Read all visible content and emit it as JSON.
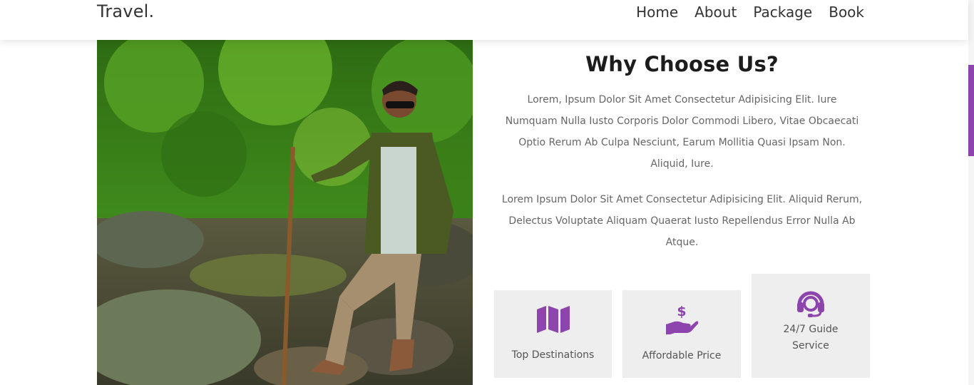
{
  "header": {
    "logo": "Travel.",
    "nav": [
      "Home",
      "About",
      "Package",
      "Book"
    ]
  },
  "about": {
    "title": "Why Choose Us?",
    "paragraphs": [
      "Lorem, Ipsum Dolor Sit Amet Consectetur Adipisicing Elit. Iure Numquam Nulla Iusto Corporis Dolor Commodi Libero, Vitae Obcaecati Optio Rerum Ab Culpa Nesciunt, Earum Mollitia Quasi Ipsam Non. Aliquid, Iure.",
      "Lorem Ipsum Dolor Sit Amet Consectetur Adipisicing Elit. Aliquid Rerum, Delectus Voluptate Aliquam Quaerat Iusto Repellendus Error Nulla Ab Atque."
    ],
    "features": [
      {
        "label": "Top Destinations",
        "icon": "map-icon"
      },
      {
        "label": "Affordable Price",
        "icon": "hand-dollar-icon"
      },
      {
        "label": "24/7 Guide Service",
        "icon": "headset-icon"
      }
    ]
  },
  "colors": {
    "accent": "#8e44ad",
    "card_bg": "#eeeeee"
  }
}
